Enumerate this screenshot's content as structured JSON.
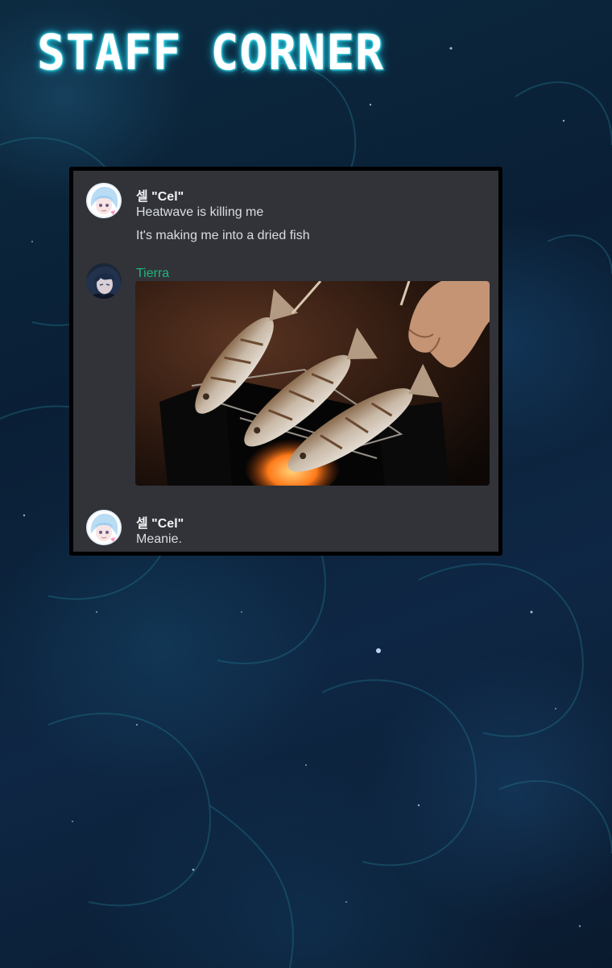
{
  "page": {
    "title": "STAFF CORNER"
  },
  "chat": {
    "messages": [
      {
        "author": "셀 \"Cel\"",
        "author_color": "#f2f3f5",
        "avatar_icon": "anime-girl-avatar",
        "lines": [
          "Heatwave is killing me",
          "It's making me into a dried fish"
        ]
      },
      {
        "author": "Tierra",
        "author_color": "#1fb57a",
        "avatar_icon": "dark-haired-avatar",
        "attachment": "grilled-fish-photo"
      },
      {
        "author": "셀 \"Cel\"",
        "author_color": "#f2f3f5",
        "avatar_icon": "anime-girl-avatar",
        "lines": [
          "Meanie."
        ]
      }
    ]
  },
  "colors": {
    "title_glow": "#2ad8ec",
    "chat_background": "#313338",
    "text": "#dbdee1",
    "username_green": "#1fb57a"
  }
}
